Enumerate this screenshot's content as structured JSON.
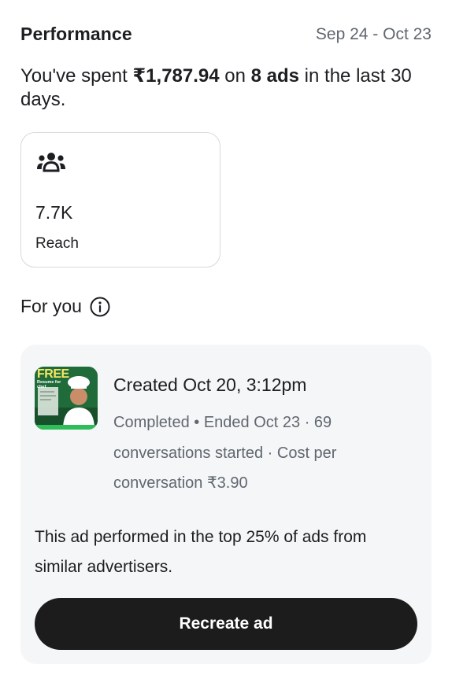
{
  "performance": {
    "title": "Performance",
    "date_range": "Sep 24 - Oct 23",
    "summary": {
      "prefix": "You've spent ",
      "amount": "₹1,787.94",
      "middle": " on ",
      "ads_count": "8 ads",
      "suffix": " in the last 30 days."
    }
  },
  "reach": {
    "icon": "people-group-icon",
    "value": "7.7K",
    "label": "Reach"
  },
  "for_you": {
    "title": "For you",
    "info_icon": "info-circle-icon"
  },
  "ad": {
    "thumbnail_text": "FREE",
    "thumbnail_subtext": "Resume for chef",
    "created": "Created Oct 20, 3:12pm",
    "details": "Completed • Ended Oct 23 · 69 conversations started · Cost per conversation ₹3.90",
    "performance_note": "This ad performed in the top 25% of ads from similar advertisers.",
    "button_label": "Recreate ad"
  },
  "colors": {
    "text_primary": "#1c1e21",
    "text_secondary": "#606770",
    "card_bg": "#f5f6f7",
    "button_bg": "#1c1c1c",
    "thumb_green": "#1f6b3a"
  }
}
